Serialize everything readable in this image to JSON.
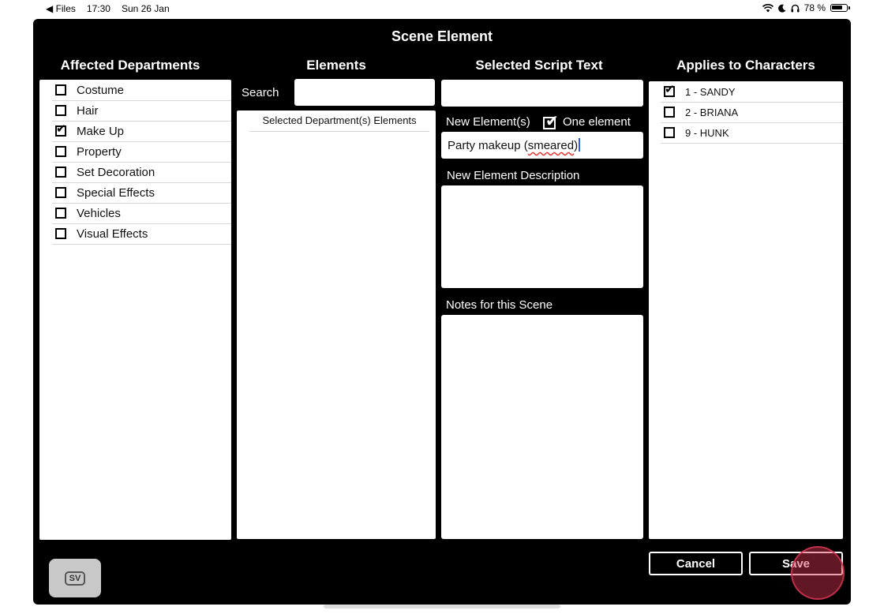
{
  "status_bar": {
    "back_app": "◀ Files",
    "time": "17:30",
    "date": "Sun 26 Jan",
    "battery": "78 %",
    "battery_fraction": 0.78
  },
  "dialog": {
    "title": "Scene Element",
    "columns": {
      "departments": "Affected Departments",
      "elements": "Elements",
      "script_text": "Selected Script Text",
      "characters": "Applies to Characters"
    }
  },
  "departments": [
    {
      "label": "Costume",
      "checked": false
    },
    {
      "label": "Hair",
      "checked": false
    },
    {
      "label": "Make Up",
      "checked": true
    },
    {
      "label": "Property",
      "checked": false
    },
    {
      "label": "Set Decoration",
      "checked": false
    },
    {
      "label": "Special Effects",
      "checked": false
    },
    {
      "label": "Vehicles",
      "checked": false
    },
    {
      "label": "Visual Effects",
      "checked": false
    }
  ],
  "elements_panel": {
    "search_label": "Search",
    "search_value": "",
    "list_header": "Selected Department(s) Elements"
  },
  "script_panel": {
    "selected_text": "",
    "new_elements_label": "New Element(s)",
    "one_element_label": "One element",
    "one_element_checked": true,
    "new_element_value_plain": "Party makeup (",
    "new_element_value_squig": "smeared",
    "new_element_value_tail": ")",
    "description_label": "New Element Description",
    "description_value": "",
    "notes_label": "Notes for this Scene",
    "notes_value": ""
  },
  "characters": [
    {
      "label": "1 - SANDY",
      "checked": true
    },
    {
      "label": "2 - BRIANA",
      "checked": false
    },
    {
      "label": "9 - HUNK",
      "checked": false
    }
  ],
  "buttons": {
    "cancel": "Cancel",
    "save": "Save"
  },
  "badge": {
    "label": "SV"
  }
}
